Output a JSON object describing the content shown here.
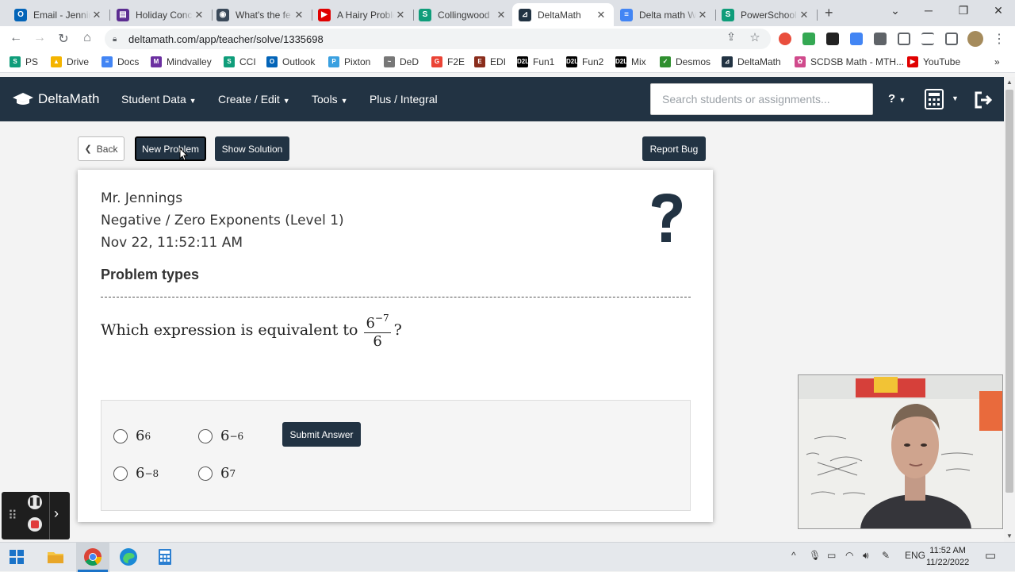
{
  "browser": {
    "tabs": [
      {
        "title": "Email - Jennings",
        "icon": "outlook-icon",
        "color": "#0364b8",
        "glyph": "O"
      },
      {
        "title": "Holiday Concert",
        "icon": "forms-icon",
        "color": "#5c2d91",
        "glyph": "▤"
      },
      {
        "title": "What's the fe",
        "icon": "globe-icon",
        "color": "#3b4a5a",
        "glyph": "◉"
      },
      {
        "title": "A Hairy Problem",
        "icon": "youtube-icon",
        "color": "#e00000",
        "glyph": "▶"
      },
      {
        "title": "Collingwood",
        "icon": "schoology-icon",
        "color": "#0f9d7a",
        "glyph": "S"
      },
      {
        "title": "DeltaMath",
        "icon": "deltamath-icon",
        "color": "#223343",
        "glyph": "⊿"
      },
      {
        "title": "Delta math W",
        "icon": "docs-icon",
        "color": "#4285f4",
        "glyph": "≡"
      },
      {
        "title": "PowerSchool",
        "icon": "schoology-icon",
        "color": "#0f9d7a",
        "glyph": "S"
      }
    ],
    "active_tab_index": 5,
    "url": "deltamath.com/app/teacher/solve/1335698",
    "bookmarks": [
      {
        "label": "PS",
        "color": "#0f9d7a",
        "glyph": "S"
      },
      {
        "label": "Drive",
        "color": "#f4b400",
        "glyph": "▲"
      },
      {
        "label": "Docs",
        "color": "#4285f4",
        "glyph": "≡"
      },
      {
        "label": "Mindvalley",
        "color": "#6b2fa0",
        "glyph": "M"
      },
      {
        "label": "CCI",
        "color": "#0f9d7a",
        "glyph": "S"
      },
      {
        "label": "Outlook",
        "color": "#0364b8",
        "glyph": "O"
      },
      {
        "label": "Pixton",
        "color": "#3aa0e0",
        "glyph": "P"
      },
      {
        "label": "DeD",
        "color": "#777777",
        "glyph": "~"
      },
      {
        "label": "F2E",
        "color": "#ea4335",
        "glyph": "G"
      },
      {
        "label": "EDI",
        "color": "#8a2d1c",
        "glyph": "E"
      },
      {
        "label": "Fun1",
        "color": "#000000",
        "glyph": "D2L"
      },
      {
        "label": "Fun2",
        "color": "#000000",
        "glyph": "D2L"
      },
      {
        "label": "Mix",
        "color": "#000000",
        "glyph": "D2L"
      },
      {
        "label": "Desmos",
        "color": "#2f8f2f",
        "glyph": "✓"
      },
      {
        "label": "DeltaMath",
        "color": "#223343",
        "glyph": "⊿"
      },
      {
        "label": "SCDSB Math - MTH...",
        "color": "#d04a8c",
        "glyph": "✿"
      },
      {
        "label": "YouTube",
        "color": "#e00000",
        "glyph": "▶"
      }
    ]
  },
  "app": {
    "logo_text": "DeltaMath",
    "nav": [
      {
        "label": "Student Data",
        "caret": true
      },
      {
        "label": "Create / Edit",
        "caret": true
      },
      {
        "label": "Tools",
        "caret": true
      },
      {
        "label": "Plus / Integral",
        "caret": false
      }
    ],
    "search_placeholder": "Search students or assignments...",
    "help_label": "?"
  },
  "actions": {
    "back": "Back",
    "new_problem": "New Problem",
    "show_solution": "Show Solution",
    "report_bug": "Report Bug"
  },
  "problem": {
    "teacher": "Mr. Jennings",
    "topic": "Negative / Zero Exponents (Level 1)",
    "timestamp": "Nov 22, 11:52:11 AM",
    "types_label": "Problem types",
    "question_text": "Which expression is equivalent to",
    "numerator_base": "6",
    "numerator_exp": "−7",
    "denominator": "6",
    "question_end": "?",
    "choices": [
      {
        "base": "6",
        "exp": "6"
      },
      {
        "base": "6",
        "exp": "−6"
      },
      {
        "base": "6",
        "exp": "−8"
      },
      {
        "base": "6",
        "exp": "7"
      }
    ],
    "submit_label": "Submit Answer"
  },
  "taskbar": {
    "time": "11:52 AM",
    "date": "11/22/2022",
    "language": "ENG"
  }
}
